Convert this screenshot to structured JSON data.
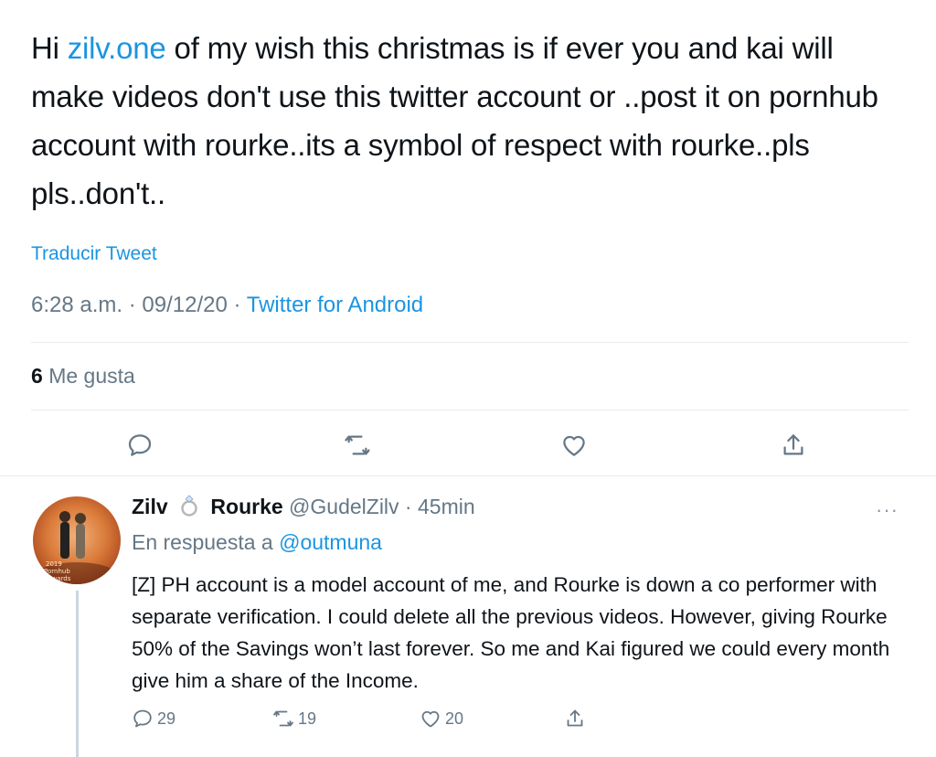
{
  "tweet": {
    "text_before_mention": "Hi ",
    "mention": "zilv.one",
    "text_after_mention": " of my wish this christmas is if ever you and kai will make videos don't use this twitter account or ..post it on pornhub account with rourke..its a symbol of respect with rourke..pls pls..don't..",
    "translate_label": "Traducir Tweet",
    "time": "6:28 a.m.",
    "date": "09/12/20",
    "source": "Twitter for Android",
    "likes_count": "6",
    "likes_label": "Me gusta"
  },
  "actions": {
    "reply_icon": "comment-icon",
    "retweet_icon": "retweet-icon",
    "like_icon": "heart-icon",
    "share_icon": "share-icon"
  },
  "reply": {
    "name_part1": "Zilv",
    "name_part2": "Rourke",
    "handle": "@GudelZilv",
    "time": "45min",
    "in_reply_label": "En respuesta a",
    "in_reply_to": "@outmuna",
    "more": "···",
    "text": "[Z] PH account is a model account of me, and Rourke is down a co performer with separate verification. I could delete all the previous videos. However, giving Rourke 50% of the Savings won’t last forever. So me and Kai figured we could every month give him a share of the Income.",
    "avatar_text": [
      "2019",
      "Pornhub",
      "Awards"
    ],
    "replies": "29",
    "retweets": "19",
    "likes": "20"
  },
  "colors": {
    "link": "#1b95e0",
    "muted": "#657786",
    "divider": "#e6ecf0"
  }
}
